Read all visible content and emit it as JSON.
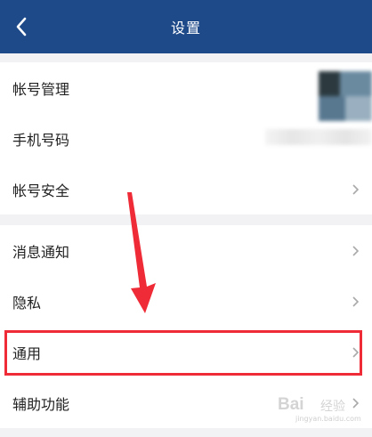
{
  "header": {
    "title": "设置",
    "background": "#1e4a8a"
  },
  "settings_groups": [
    {
      "items": [
        {
          "label": "帐号管理",
          "trailing": "blurred-avatar"
        },
        {
          "label": "手机号码",
          "trailing": "blurred-phone-number"
        },
        {
          "label": "帐号安全",
          "trailing": "chevron-right-icon"
        }
      ]
    },
    {
      "items": [
        {
          "label": "消息通知",
          "trailing": "chevron-right-icon"
        },
        {
          "label": "隐私",
          "trailing": "chevron-right-icon"
        },
        {
          "label": "通用",
          "trailing": "chevron-right-icon",
          "highlighted": true
        },
        {
          "label": "辅助功能",
          "trailing": "chevron-right-icon"
        }
      ]
    }
  ],
  "annotation": {
    "highlight_color": "#ee2b36",
    "arrow_color": "#ee2b36"
  },
  "watermark": {
    "text": "Bai",
    "sub": "经验",
    "url": "jingyan.baidu.com"
  }
}
